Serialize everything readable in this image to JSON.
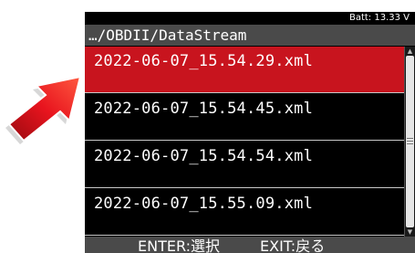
{
  "status": {
    "battery": "Batt: 13.33 V"
  },
  "path": "…/OBDII/DataStream",
  "files": [
    {
      "name": "2022-06-07_15.54.29.xml",
      "selected": true
    },
    {
      "name": "2022-06-07_15.54.45.xml",
      "selected": false
    },
    {
      "name": "2022-06-07_15.54.54.xml",
      "selected": false
    },
    {
      "name": "2022-06-07_15.55.09.xml",
      "selected": false
    }
  ],
  "footer": {
    "enter": "ENTER:選択",
    "exit": "EXIT:戻る"
  },
  "colors": {
    "selection": "#c8141e",
    "bars": "#4a4a4a",
    "pointer_arrow": "#e8141e"
  },
  "icons": [
    "pointer-arrow-icon",
    "scroll-up-icon",
    "scroll-down-icon"
  ]
}
